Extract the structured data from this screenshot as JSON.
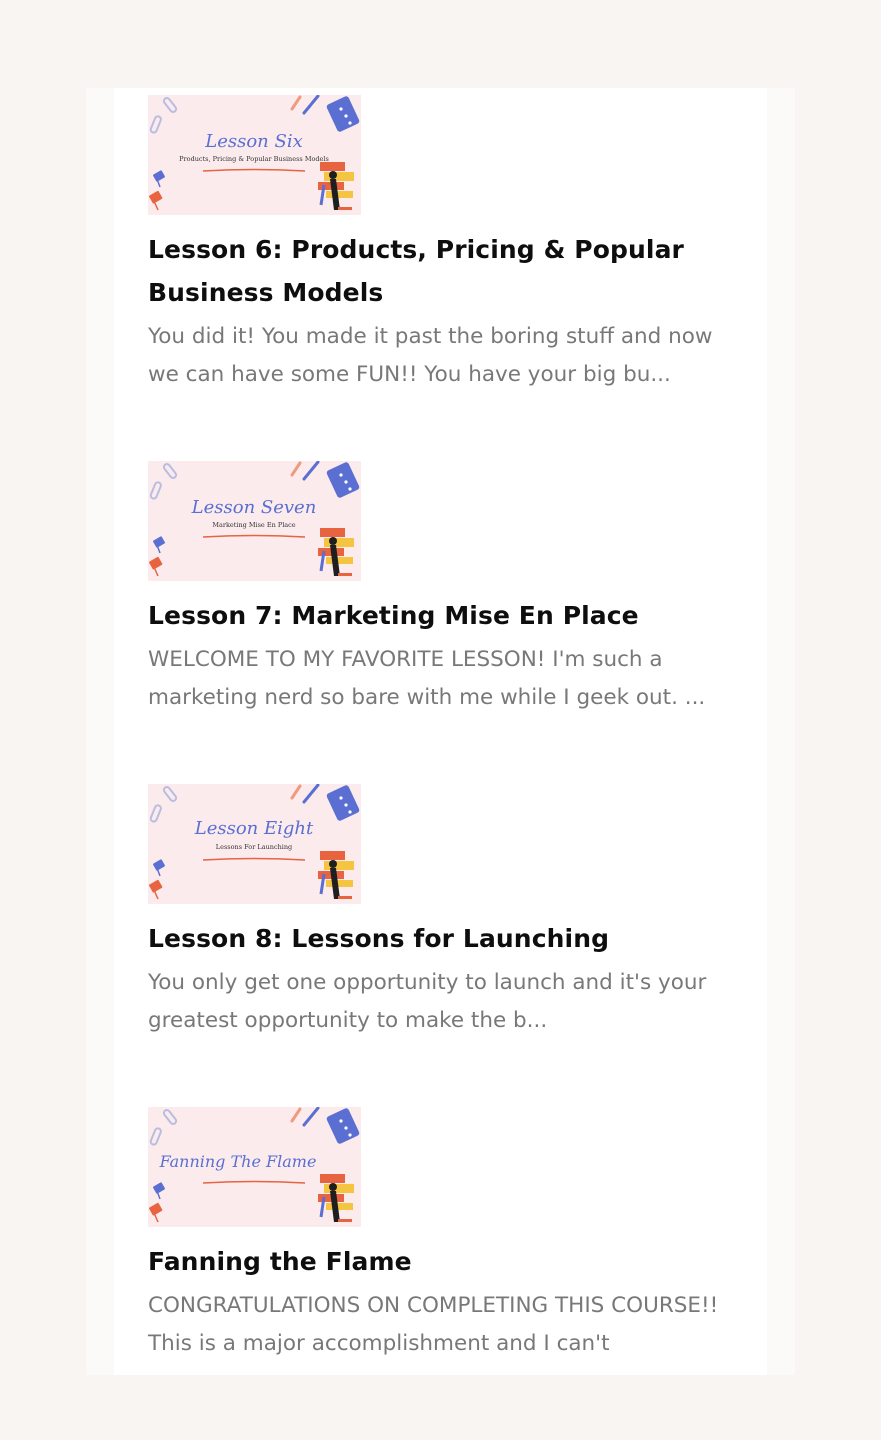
{
  "lessons": [
    {
      "thumb_script": "Lesson Six",
      "thumb_subtitle": "Products, Pricing & Popular Business Models",
      "title": "Lesson 6: Products, Pricing & Popular Business Models",
      "description": "You did it! You made it past the boring stuff and now we can have some FUN!! You have your big bu..."
    },
    {
      "thumb_script": "Lesson Seven",
      "thumb_subtitle": "Marketing Mise En Place",
      "title": "Lesson 7: Marketing Mise En Place",
      "description": "WELCOME TO MY FAVORITE LESSON!  I'm such a marketing nerd so bare with me while I geek out. ..."
    },
    {
      "thumb_script": "Lesson Eight",
      "thumb_subtitle": "Lessons For Launching",
      "title": "Lesson 8: Lessons for Launching",
      "description": "You only get one opportunity to launch and it's your greatest opportunity to make the b..."
    },
    {
      "thumb_script": "Fanning The Flame",
      "thumb_subtitle": "",
      "title": "Fanning the Flame",
      "description": "CONGRATULATIONS ON COMPLETING THIS COURSE!! This is a major accomplishment and I can't"
    }
  ],
  "colors": {
    "page_bg": "#f9f5f3",
    "card_bg": "#ffffff",
    "thumb_bg": "#fbebed",
    "script_blue": "#5a6fd1",
    "accent_coral": "#e8633f",
    "title_text": "#0e0e0e",
    "desc_text": "#787878"
  }
}
